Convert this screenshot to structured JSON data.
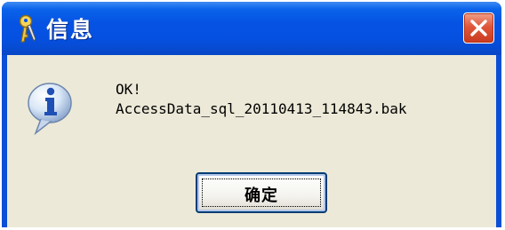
{
  "window": {
    "title": "信息",
    "title_icon": "key-icon",
    "close_icon": "close-icon"
  },
  "message": {
    "icon": "info-icon",
    "line1": "OK!",
    "line2": "AccessData_sql_20110413_114843.bak"
  },
  "buttons": {
    "ok_label": "确定"
  },
  "colors": {
    "titlebar": "#0653e3",
    "client_bg": "#ece9d8",
    "close_button": "#e0573a"
  }
}
